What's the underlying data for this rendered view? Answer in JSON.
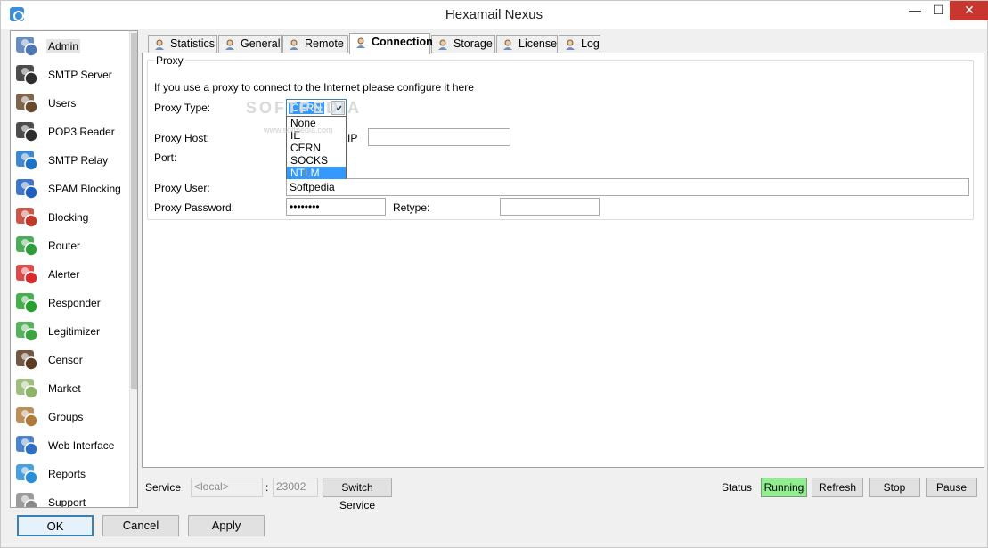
{
  "window": {
    "title": "Hexamail Nexus"
  },
  "sidebar": {
    "items": [
      {
        "label": "Admin",
        "icon": "admin-icon",
        "color": "#4d79b3"
      },
      {
        "label": "SMTP Server",
        "icon": "smtp-server-icon",
        "color": "#2d2d2d"
      },
      {
        "label": "Users",
        "icon": "users-icon",
        "color": "#6a4a2e"
      },
      {
        "label": "POP3 Reader",
        "icon": "pop3-reader-icon",
        "color": "#2d2d2d"
      },
      {
        "label": "SMTP Relay",
        "icon": "smtp-relay-icon",
        "color": "#1e73c8"
      },
      {
        "label": "SPAM Blocking",
        "icon": "spam-blocking-icon",
        "color": "#1f5fc0"
      },
      {
        "label": "Blocking",
        "icon": "blocking-icon",
        "color": "#c0392b"
      },
      {
        "label": "Router",
        "icon": "router-icon",
        "color": "#2e9e3c"
      },
      {
        "label": "Alerter",
        "icon": "alerter-icon",
        "color": "#d62c2c"
      },
      {
        "label": "Responder",
        "icon": "responder-icon",
        "color": "#27a02f"
      },
      {
        "label": "Legitimizer",
        "icon": "legitimizer-icon",
        "color": "#3aa541"
      },
      {
        "label": "Censor",
        "icon": "censor-icon",
        "color": "#5b3b22"
      },
      {
        "label": "Market",
        "icon": "market-icon",
        "color": "#8fb36b"
      },
      {
        "label": "Groups",
        "icon": "groups-icon",
        "color": "#b07a3c"
      },
      {
        "label": "Web Interface",
        "icon": "web-interface-icon",
        "color": "#2f6fc4"
      },
      {
        "label": "Reports",
        "icon": "reports-icon",
        "color": "#2a8fd6"
      },
      {
        "label": "Support",
        "icon": "support-icon",
        "color": "#8a8a8a"
      }
    ]
  },
  "tabs": [
    {
      "label": "Statistics"
    },
    {
      "label": "General"
    },
    {
      "label": "Remote"
    },
    {
      "label": "Connection"
    },
    {
      "label": "Storage"
    },
    {
      "label": "License"
    },
    {
      "label": "Log"
    }
  ],
  "proxy": {
    "group_title": "Proxy",
    "intro": "If you use a proxy to connect to the Internet please configure it here",
    "type_label": "Proxy Type:",
    "type_value": "CERN",
    "type_options": [
      "None",
      "IE",
      "CERN",
      "SOCKS",
      "NTLM"
    ],
    "host_label": "Proxy Host:",
    "ip_label": "IP",
    "ip_value": "",
    "port_label": "Port:",
    "user_label": "Proxy User:",
    "user_value": "Softpedia",
    "password_label": "Proxy Password:",
    "password_value": "••••••••",
    "retype_label": "Retype:",
    "retype_value": ""
  },
  "watermark": {
    "text": "SOFTPEDIA",
    "url": "www.softpedia.com"
  },
  "footer": {
    "service_label": "Service",
    "service_host": "<local>",
    "colon": ":",
    "service_port": "23002",
    "switch_label": "Switch Service",
    "status_label": "Status",
    "status_value": "Running",
    "status_color": "#90ee90",
    "refresh_label": "Refresh",
    "stop_label": "Stop",
    "pause_label": "Pause"
  },
  "dialog_buttons": {
    "ok": "OK",
    "cancel": "Cancel",
    "apply": "Apply"
  }
}
